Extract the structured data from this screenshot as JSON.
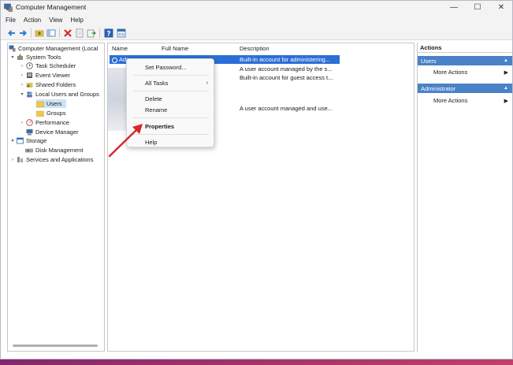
{
  "window": {
    "title": "Computer Management",
    "minimize": "—",
    "maximize": "☐",
    "close": "✕"
  },
  "menu": [
    "File",
    "Action",
    "View",
    "Help"
  ],
  "tree": [
    {
      "label": "Computer Management (Local",
      "indent": 0,
      "caret": "",
      "icon": "computer-icon"
    },
    {
      "label": "System Tools",
      "indent": 1,
      "caret": "v",
      "icon": "tools-icon"
    },
    {
      "label": "Task Scheduler",
      "indent": 2,
      "caret": ">",
      "icon": "clock-icon"
    },
    {
      "label": "Event Viewer",
      "indent": 2,
      "caret": ">",
      "icon": "event-icon"
    },
    {
      "label": "Shared Folders",
      "indent": 2,
      "caret": ">",
      "icon": "folder-icon"
    },
    {
      "label": "Local Users and Groups",
      "indent": 2,
      "caret": "v",
      "icon": "users-icon"
    },
    {
      "label": "Users",
      "indent": 3,
      "caret": "",
      "icon": "folder-icon",
      "selected": true
    },
    {
      "label": "Groups",
      "indent": 3,
      "caret": "",
      "icon": "folder-icon"
    },
    {
      "label": "Performance",
      "indent": 2,
      "caret": ">",
      "icon": "performance-icon"
    },
    {
      "label": "Device Manager",
      "indent": 2,
      "caret": "",
      "icon": "device-icon"
    },
    {
      "label": "Storage",
      "indent": 1,
      "caret": "v",
      "icon": "storage-icon"
    },
    {
      "label": "Disk Management",
      "indent": 2,
      "caret": "",
      "icon": "disk-icon"
    },
    {
      "label": "Services and Applications",
      "indent": 1,
      "caret": ">",
      "icon": "services-icon"
    }
  ],
  "list": {
    "columns": [
      "Name",
      "Full Name",
      "Description"
    ],
    "rows": [
      {
        "name": "Adm",
        "full_name": "",
        "description": "Built-in account for administering...",
        "selected": true
      },
      {
        "name": "",
        "full_name": "",
        "description": "A user account managed by the s..."
      },
      {
        "name": "",
        "full_name": "",
        "description": "Built-in account for guest access t..."
      },
      {
        "name": "",
        "full_name": "",
        "description": ""
      },
      {
        "name": "",
        "full_name": "",
        "description": ""
      },
      {
        "name": "",
        "full_name": "",
        "description": "A user account managed and use..."
      }
    ]
  },
  "context_menu": {
    "set_password": "Set Password...",
    "all_tasks": "All Tasks",
    "delete": "Delete",
    "rename": "Rename",
    "properties": "Properties",
    "help": "Help",
    "submenu_arrow": "›"
  },
  "actions": {
    "header": "Actions",
    "sections": [
      {
        "title": "Users",
        "item": "More Actions"
      },
      {
        "title": "Administrator",
        "item": "More Actions"
      }
    ]
  },
  "colors": {
    "selection": "#2b6fd6",
    "section_header": "#4a82c8",
    "arrow": "#d9262b"
  }
}
